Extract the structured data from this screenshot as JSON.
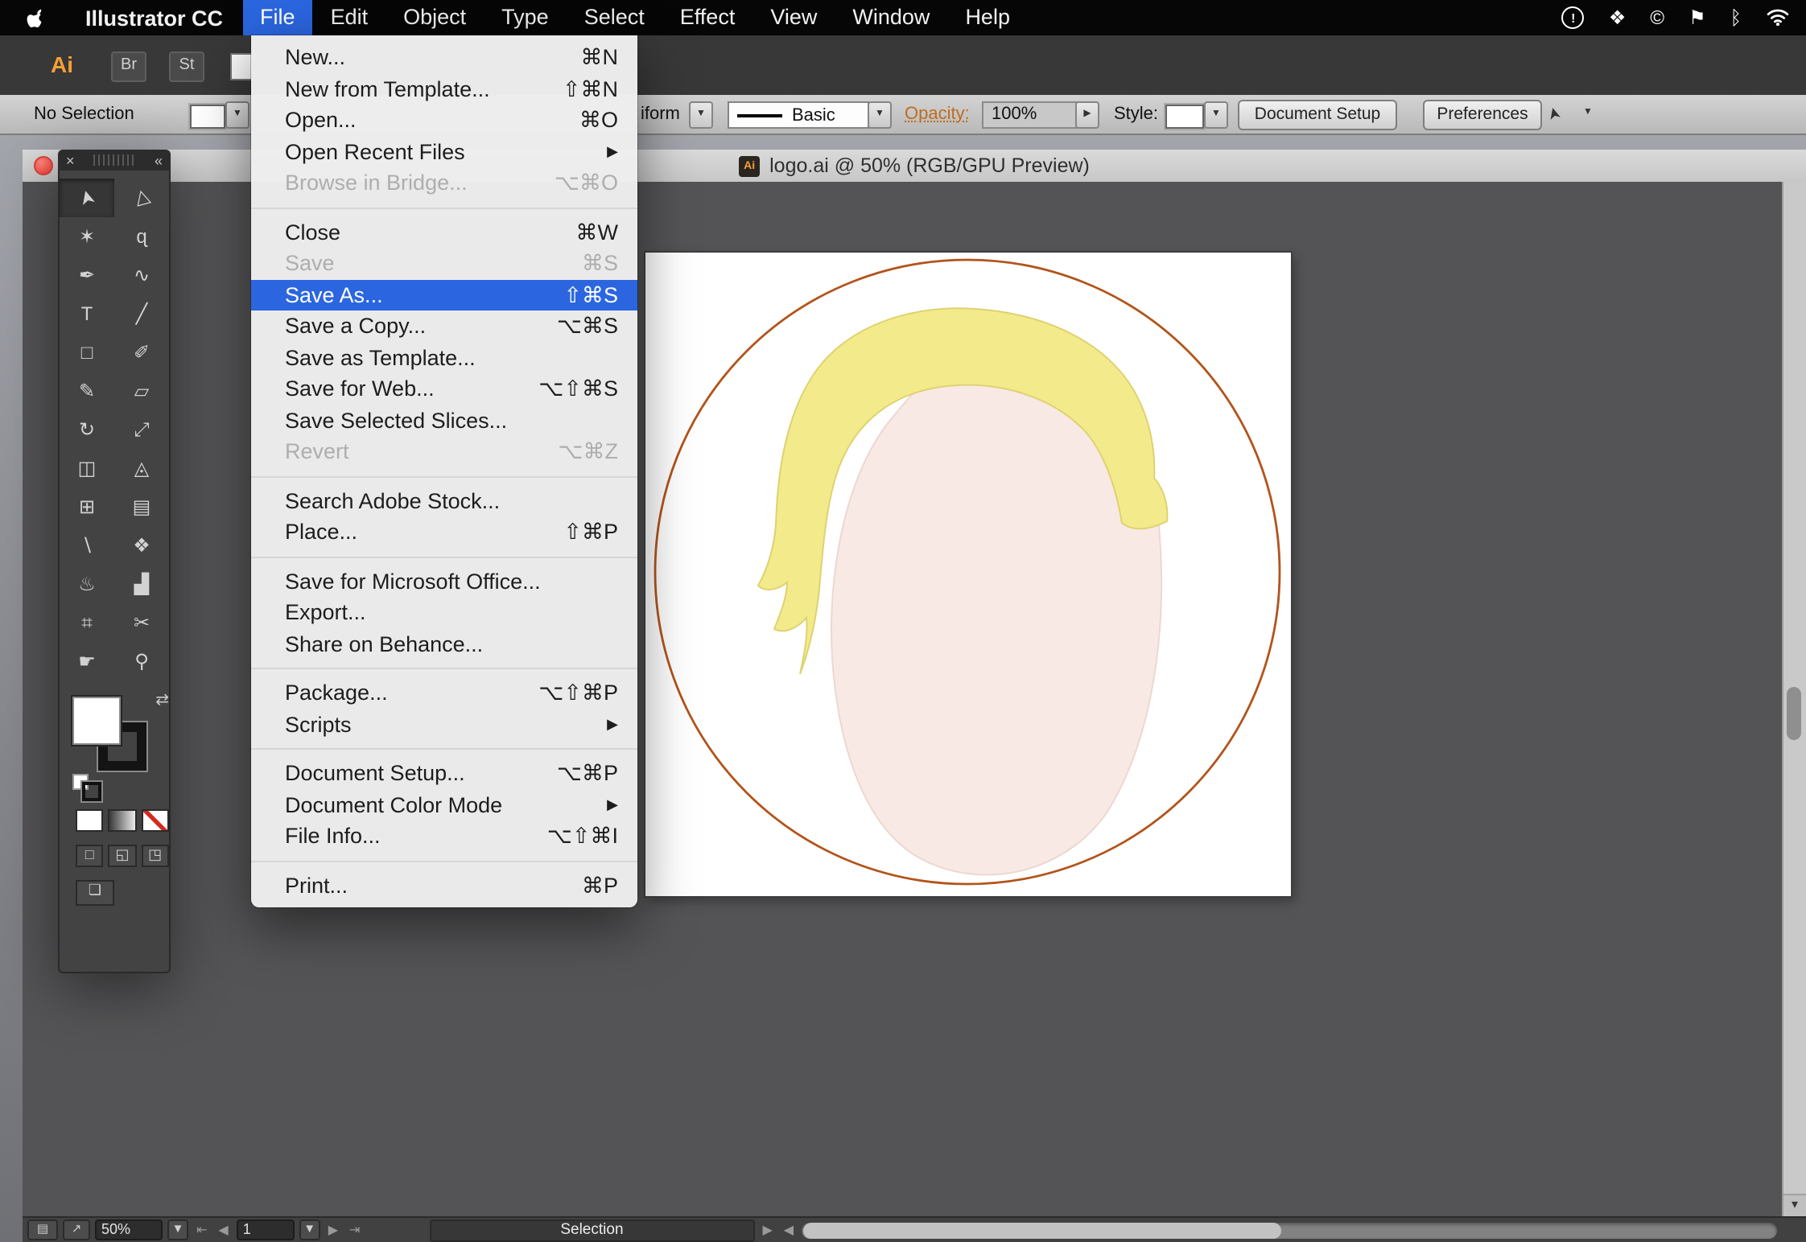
{
  "menu_bar": {
    "app_name": "Illustrator CC",
    "menus": [
      "File",
      "Edit",
      "Object",
      "Type",
      "Select",
      "Effect",
      "View",
      "Window",
      "Help"
    ],
    "active_menu": "File",
    "status_icons": {
      "alert": "!",
      "dropbox": "❖",
      "creative_cloud": "©",
      "bookmark": "⚑",
      "bluetooth": "ᛒ"
    }
  },
  "glyphs": {
    "submenu": "▶",
    "dropdown": "▼",
    "stepper_right": "▶",
    "down_small": "▾"
  },
  "file_menu": {
    "items": [
      {
        "label": "New...",
        "shortcut": "⌘N"
      },
      {
        "label": "New from Template...",
        "shortcut": "⇧⌘N"
      },
      {
        "label": "Open...",
        "shortcut": "⌘O"
      },
      {
        "label": "Open Recent Files",
        "shortcut": ""
      },
      {
        "label": "Browse in Bridge...",
        "shortcut": "⌥⌘O"
      },
      {
        "label": "Close",
        "shortcut": "⌘W"
      },
      {
        "label": "Save",
        "shortcut": "⌘S"
      },
      {
        "label": "Save As...",
        "shortcut": "⇧⌘S"
      },
      {
        "label": "Save a Copy...",
        "shortcut": "⌥⌘S"
      },
      {
        "label": "Save as Template...",
        "shortcut": ""
      },
      {
        "label": "Save for Web...",
        "shortcut": "⌥⇧⌘S"
      },
      {
        "label": "Save Selected Slices...",
        "shortcut": ""
      },
      {
        "label": "Revert",
        "shortcut": "⌥⌘Z"
      },
      {
        "label": "Search Adobe Stock...",
        "shortcut": ""
      },
      {
        "label": "Place...",
        "shortcut": "⇧⌘P"
      },
      {
        "label": "Save for Microsoft Office...",
        "shortcut": ""
      },
      {
        "label": "Export...",
        "shortcut": ""
      },
      {
        "label": "Share on Behance...",
        "shortcut": ""
      },
      {
        "label": "Package...",
        "shortcut": "⌥⇧⌘P"
      },
      {
        "label": "Scripts",
        "shortcut": ""
      },
      {
        "label": "Document Setup...",
        "shortcut": "⌥⌘P"
      },
      {
        "label": "Document Color Mode",
        "shortcut": ""
      },
      {
        "label": "File Info...",
        "shortcut": "⌥⇧⌘I"
      },
      {
        "label": "Print...",
        "shortcut": "⌘P"
      }
    ]
  },
  "app_bar": {
    "ai_logo": "Ai",
    "bridge_button": "Br",
    "stock_button": "St"
  },
  "control_bar": {
    "selection_status": "No Selection",
    "stroke_profile_visible": "iform",
    "brush_value": "Basic",
    "opacity_label": "Opacity:",
    "opacity_value": "100%",
    "style_label": "Style:",
    "document_setup_button": "Document Setup",
    "preferences_button": "Preferences",
    "cursor_icon_glyph": "➤"
  },
  "document_window": {
    "title": "logo.ai @ 50% (RGB/GPU Preview)",
    "file_icon_text": "Ai"
  },
  "tools_panel": {
    "close_glyph": "×",
    "collapse_glyph": "«",
    "swap_glyph": "⇄",
    "screen_mode_glyph": "❏",
    "items": [
      {
        "name": "selection-tool",
        "glyph": "➤"
      },
      {
        "name": "direct-selection-tool",
        "glyph": "▷"
      },
      {
        "name": "magic-wand-tool",
        "glyph": "✶"
      },
      {
        "name": "lasso-tool",
        "glyph": "ɋ"
      },
      {
        "name": "pen-tool",
        "glyph": "✒"
      },
      {
        "name": "curvature-tool",
        "glyph": "∿"
      },
      {
        "name": "type-tool",
        "glyph": "T"
      },
      {
        "name": "line-segment-tool",
        "glyph": "╱"
      },
      {
        "name": "rectangle-tool",
        "glyph": "□"
      },
      {
        "name": "paintbrush-tool",
        "glyph": "✐"
      },
      {
        "name": "pencil-tool",
        "glyph": "✎"
      },
      {
        "name": "eraser-tool",
        "glyph": "▱"
      },
      {
        "name": "rotate-tool",
        "glyph": "↻"
      },
      {
        "name": "scale-tool",
        "glyph": "⤢"
      },
      {
        "name": "shape-builder-tool",
        "glyph": "◫"
      },
      {
        "name": "perspective-grid-tool",
        "glyph": "◬"
      },
      {
        "name": "mesh-tool",
        "glyph": "⊞"
      },
      {
        "name": "gradient-tool",
        "glyph": "▤"
      },
      {
        "name": "eyedropper-tool",
        "glyph": "∖"
      },
      {
        "name": "blend-tool",
        "glyph": "❖"
      },
      {
        "name": "symbol-sprayer-tool",
        "glyph": "♨"
      },
      {
        "name": "column-graph-tool",
        "glyph": "▟"
      },
      {
        "name": "artboard-tool",
        "glyph": "⌗"
      },
      {
        "name": "slice-tool",
        "glyph": "✂"
      },
      {
        "name": "hand-tool",
        "glyph": "☛"
      },
      {
        "name": "zoom-tool",
        "glyph": "⚲"
      }
    ],
    "draw_modes": [
      {
        "name": "draw-normal",
        "glyph": "□"
      },
      {
        "name": "draw-behind",
        "glyph": "◱"
      },
      {
        "name": "draw-inside",
        "glyph": "◳"
      }
    ]
  },
  "status_bar": {
    "left_icon_1": "▤",
    "left_icon_2": "↗",
    "zoom_value": "50%",
    "nav_first": "⇤",
    "nav_prev": "◀",
    "artboard_value": "1",
    "nav_next": "▶",
    "nav_last": "⇥",
    "tool_status": "Selection",
    "status_menu_arrow": "▶",
    "hscroll_left_arrow": "◀"
  },
  "colors": {
    "menu_highlight": "#2b66e0",
    "opacity_label": "#bd6d1f",
    "ai_orange": "#f7a037",
    "circle_stroke": "#b2541b",
    "hair_fill": "#f3eb8b",
    "hair_stroke": "#ded271",
    "face_fill": "#f9e9e4",
    "face_stroke": "#ecd8d1"
  }
}
